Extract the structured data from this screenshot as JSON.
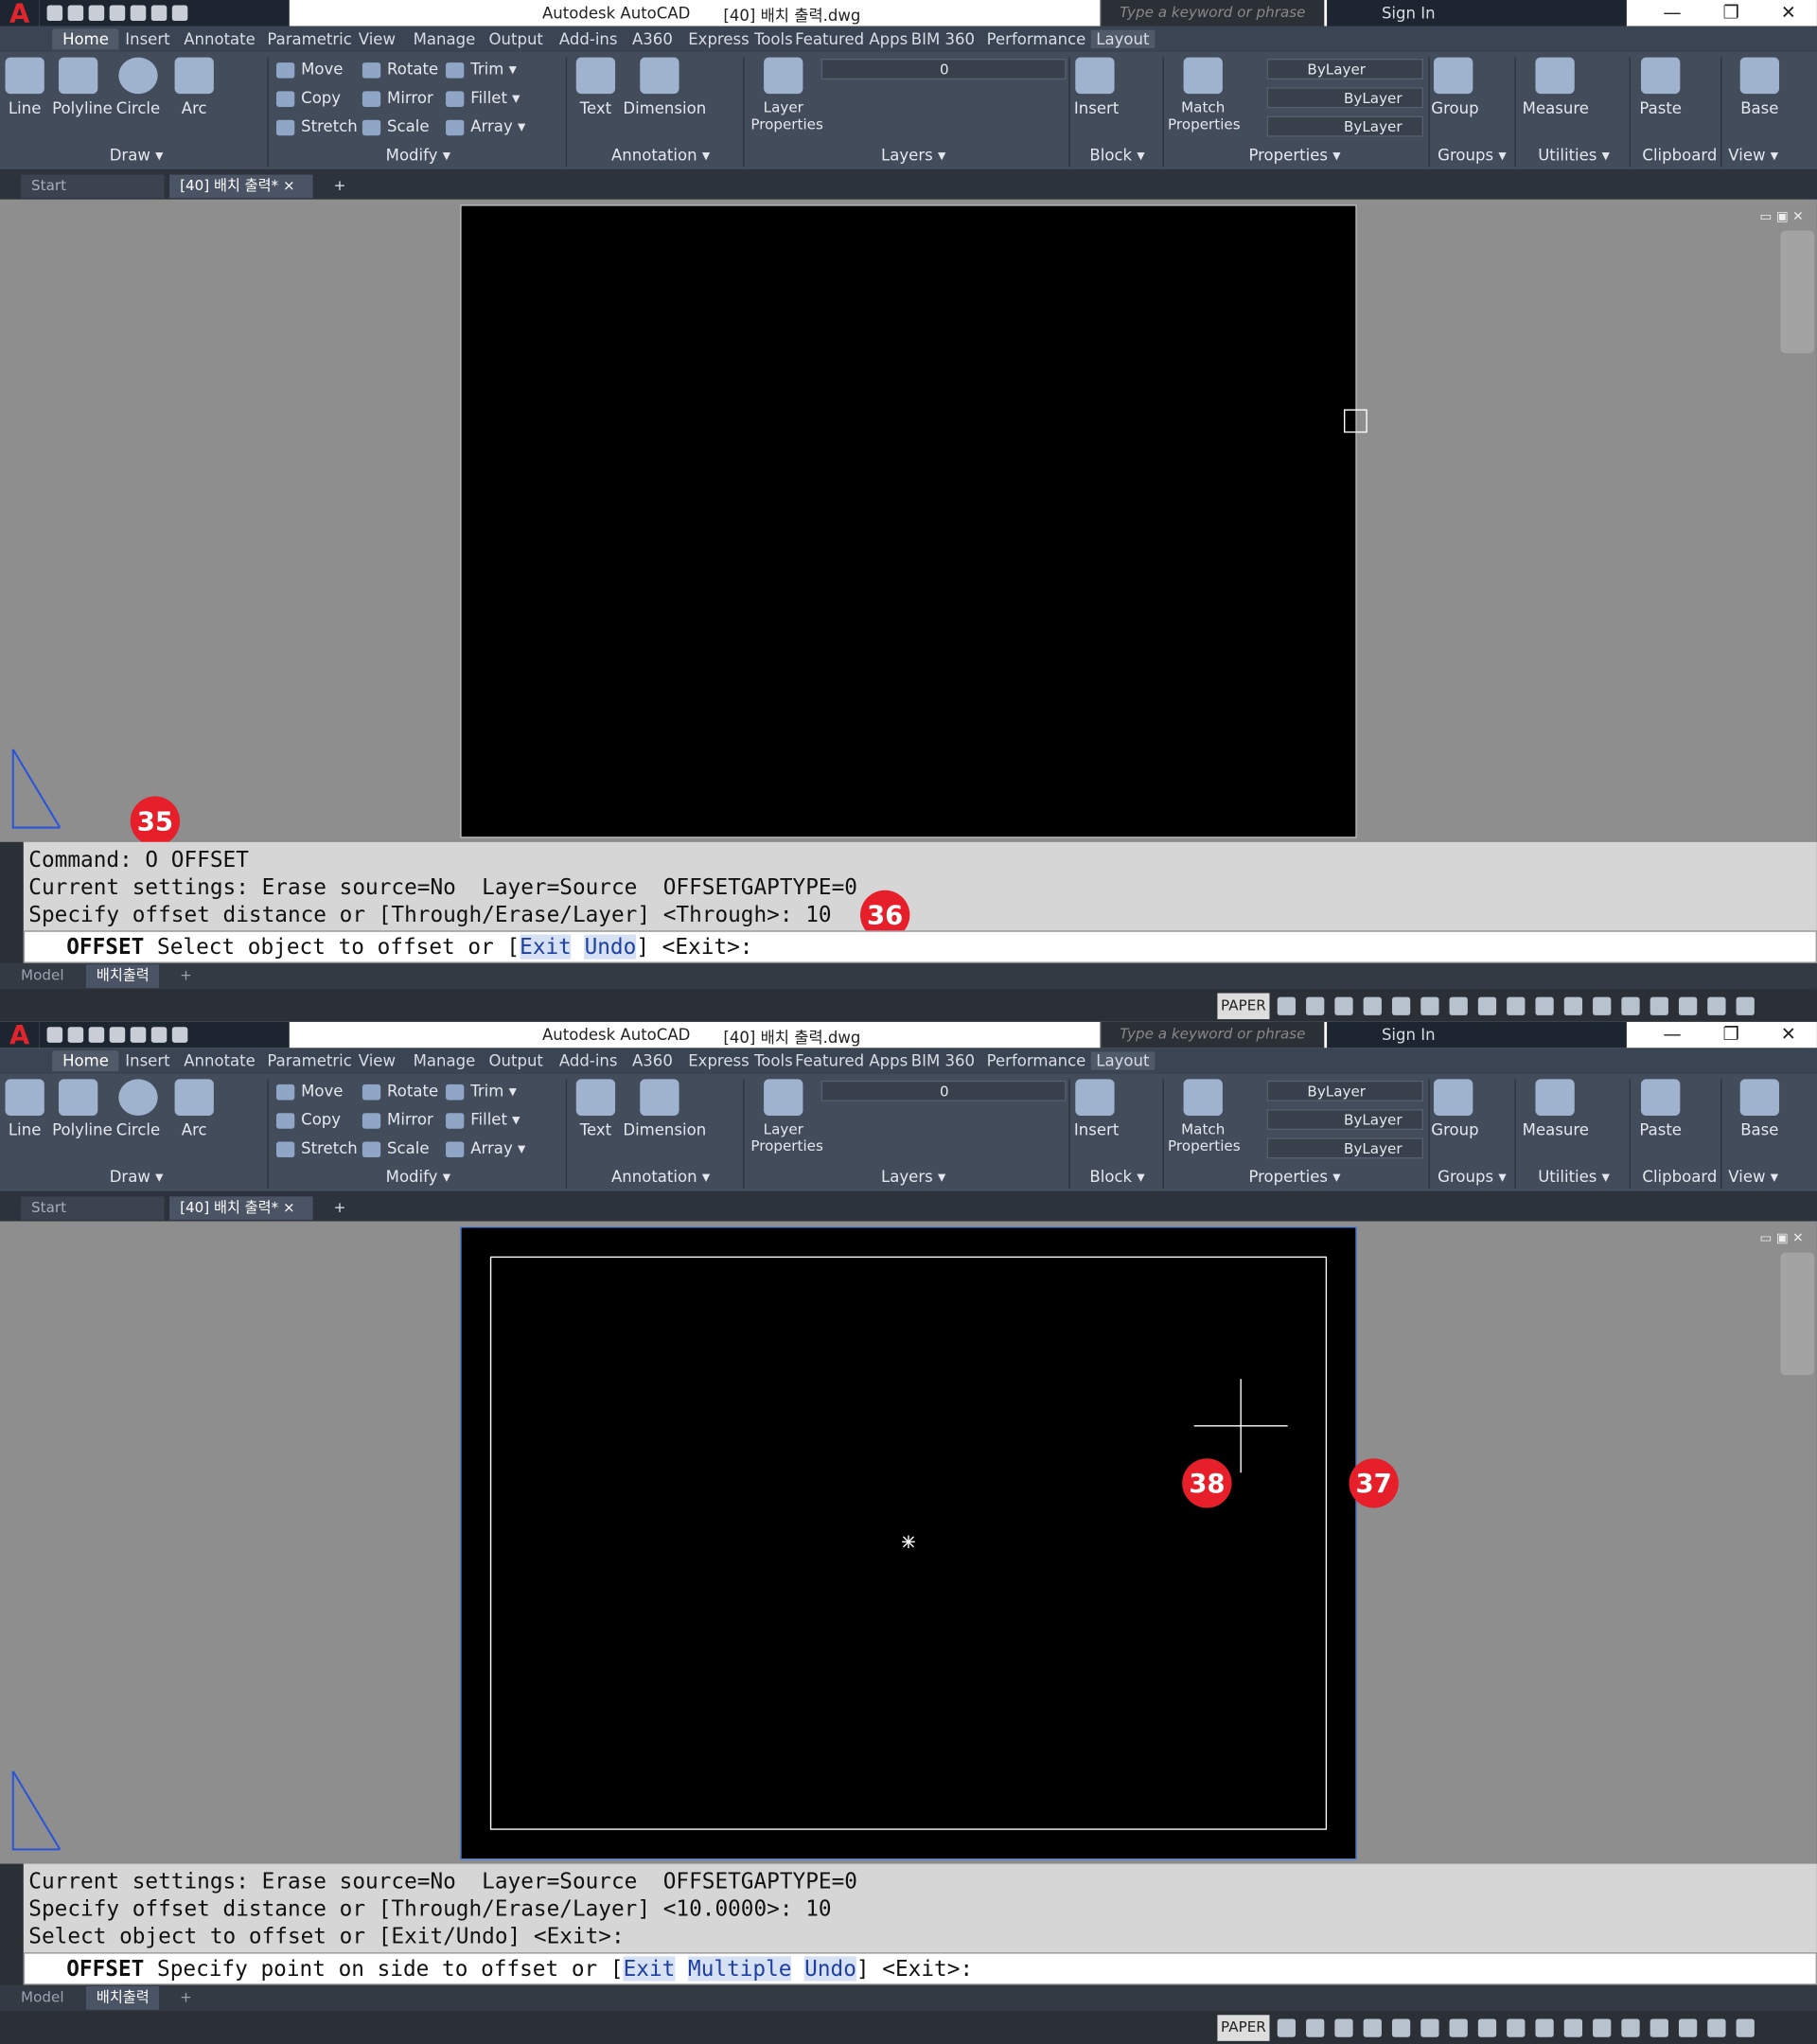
{
  "app": {
    "logo": "A",
    "title": "Autodesk AutoCAD",
    "document": "[40] 배치 출력.dwg",
    "search_placeholder": "Type a keyword or phrase",
    "sign_in": "Sign In",
    "window_controls": [
      "—",
      "❐",
      "✕"
    ]
  },
  "ribbon": {
    "tabs": [
      "Home",
      "Insert",
      "Annotate",
      "Parametric",
      "View",
      "Manage",
      "Output",
      "Add-ins",
      "A360",
      "Express Tools",
      "Featured Apps",
      "BIM 360",
      "Performance",
      "Layout"
    ],
    "active_tab": "Home",
    "draw": {
      "line": "Line",
      "polyline": "Polyline",
      "circle": "Circle",
      "arc": "Arc",
      "footer": "Draw ▾"
    },
    "modify": {
      "move": "Move",
      "rotate": "Rotate",
      "trim": "Trim ▾",
      "copy": "Copy",
      "mirror": "Mirror",
      "fillet": "Fillet ▾",
      "stretch": "Stretch",
      "scale": "Scale",
      "array": "Array ▾",
      "footer": "Modify ▾"
    },
    "annotation": {
      "text": "Text",
      "dimension": "Dimension",
      "footer": "Annotation ▾"
    },
    "layers": {
      "layer_properties": "Layer Properties",
      "current_layer": "0",
      "footer": "Layers ▾"
    },
    "block": {
      "insert": "Insert",
      "footer": "Block ▾"
    },
    "properties": {
      "match_properties": "Match Properties",
      "color": "ByLayer",
      "linetype": "ByLayer",
      "lineweight": "ByLayer",
      "footer": "Properties ▾"
    },
    "groups": {
      "group": "Group",
      "footer": "Groups ▾"
    },
    "utilities": {
      "measure": "Measure",
      "footer": "Utilities ▾"
    },
    "clipboard": {
      "paste": "Paste",
      "footer": "Clipboard"
    },
    "view": {
      "base": "Base",
      "footer": "View ▾"
    }
  },
  "file_tabs": {
    "start": "Start",
    "doc": "[40] 배치 출력*",
    "close": "×",
    "new": "+"
  },
  "layout_tabs": {
    "model": "Model",
    "layout": "배치출력",
    "add": "+"
  },
  "status": {
    "paper": "PAPER"
  },
  "panel1": {
    "callouts": {
      "a": "35",
      "b": "36"
    },
    "history": [
      "Command: O OFFSET",
      "Current settings: Erase source=No  Layer=Source  OFFSETGAPTYPE=0",
      "Specify offset distance or [Through/Erase/Layer] <Through>: 10"
    ],
    "prompt_cmd": "OFFSET",
    "prompt_text": " Select object to offset or [",
    "kw1": "Exit",
    "kw2": "Undo",
    "prompt_end": "] <Exit>:"
  },
  "panel2": {
    "callouts": {
      "a": "37",
      "b": "38"
    },
    "history": [
      "Current settings: Erase source=No  Layer=Source  OFFSETGAPTYPE=0",
      "Specify offset distance or [Through/Erase/Layer] <10.0000>: 10",
      "Select object to offset or [Exit/Undo] <Exit>:"
    ],
    "prompt_cmd": "OFFSET",
    "prompt_text": " Specify point on side to offset or [",
    "kw1": "Exit",
    "kw2": "Multiple",
    "kw3": "Undo",
    "prompt_end": "] <Exit>:"
  }
}
